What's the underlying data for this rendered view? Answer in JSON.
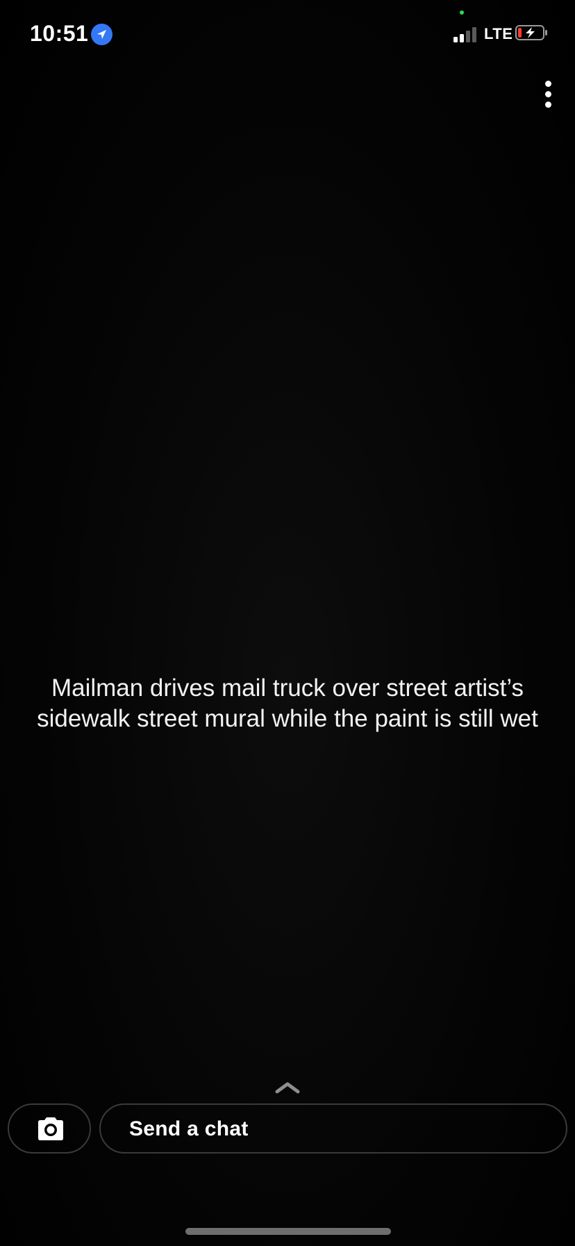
{
  "status_bar": {
    "time": "10:51",
    "network": "LTE",
    "signal_bars_active": 2,
    "signal_bars_total": 4,
    "battery_charging": true,
    "battery_level_color": "#ff3b30",
    "location_icon": "location-arrow-icon",
    "location_color": "#3478f6",
    "privacy_indicator_color": "#32d74b"
  },
  "header": {
    "more_icon": "more-vertical-icon"
  },
  "story": {
    "caption": "Mailman drives mail truck over street artist’s sidewalk street mural while the paint is still wet"
  },
  "footer": {
    "expand_icon": "chevron-up-icon",
    "camera_icon": "camera-icon",
    "chat_placeholder": "Send a chat"
  }
}
